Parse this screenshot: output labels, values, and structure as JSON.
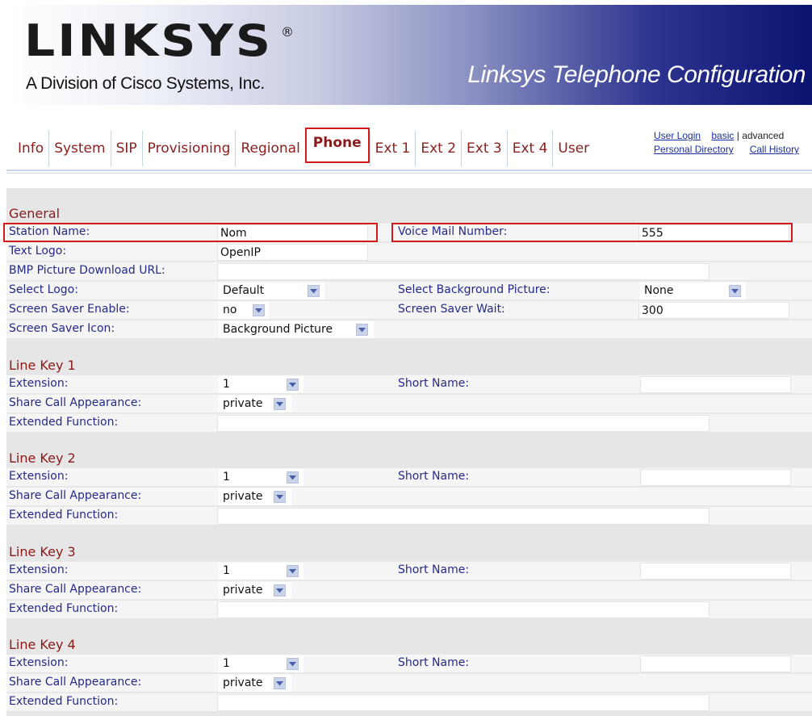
{
  "header": {
    "logo_text": "LINKSYS",
    "logo_registered": "®",
    "logo_subtitle": "A Division of Cisco Systems, Inc.",
    "title": "Linksys Telephone Configuration"
  },
  "tabs": [
    {
      "label": "Info"
    },
    {
      "label": "System"
    },
    {
      "label": "SIP"
    },
    {
      "label": "Provisioning"
    },
    {
      "label": "Regional"
    },
    {
      "label": "Phone"
    },
    {
      "label": "Ext 1"
    },
    {
      "label": "Ext 2"
    },
    {
      "label": "Ext 3"
    },
    {
      "label": "Ext 4"
    },
    {
      "label": "User"
    }
  ],
  "active_tab": "Phone",
  "top_links": {
    "user_login": "User Login",
    "basic": "basic",
    "separator": "|",
    "advanced": "advanced",
    "personal_directory": "Personal Directory",
    "call_history": "Call History"
  },
  "general": {
    "title": "General",
    "station_name_label": "Station Name:",
    "station_name_value": "Nom",
    "voice_mail_label": "Voice Mail Number:",
    "voice_mail_value": "555",
    "text_logo_label": "Text Logo:",
    "text_logo_value": "OpenIP",
    "bmp_url_label": "BMP Picture Download URL:",
    "bmp_url_value": "",
    "select_logo_label": "Select Logo:",
    "select_logo_value": "Default",
    "select_bg_label": "Select Background Picture:",
    "select_bg_value": "None",
    "screen_saver_enable_label": "Screen Saver Enable:",
    "screen_saver_enable_value": "no",
    "screen_saver_wait_label": "Screen Saver Wait:",
    "screen_saver_wait_value": "300",
    "screen_saver_icon_label": "Screen Saver Icon:",
    "screen_saver_icon_value": "Background Picture"
  },
  "line_keys": [
    {
      "title": "Line Key 1",
      "extension_label": "Extension:",
      "extension_value": "1",
      "short_name_label": "Short Name:",
      "short_name_value": "",
      "share_label": "Share Call Appearance:",
      "share_value": "private",
      "extended_label": "Extended Function:",
      "extended_value": ""
    },
    {
      "title": "Line Key 2",
      "extension_label": "Extension:",
      "extension_value": "1",
      "short_name_label": "Short Name:",
      "short_name_value": "",
      "share_label": "Share Call Appearance:",
      "share_value": "private",
      "extended_label": "Extended Function:",
      "extended_value": ""
    },
    {
      "title": "Line Key 3",
      "extension_label": "Extension:",
      "extension_value": "1",
      "short_name_label": "Short Name:",
      "short_name_value": "",
      "share_label": "Share Call Appearance:",
      "share_value": "private",
      "extended_label": "Extended Function:",
      "extended_value": ""
    },
    {
      "title": "Line Key 4",
      "extension_label": "Extension:",
      "extension_value": "1",
      "short_name_label": "Short Name:",
      "short_name_value": "",
      "share_label": "Share Call Appearance:",
      "share_value": "private",
      "extended_label": "Extended Function:",
      "extended_value": ""
    }
  ],
  "colors": {
    "label_blue": "#242a8a",
    "section_red": "#8b1a1a",
    "highlight_red": "#d11a1a",
    "banner_navy": "#0a1370"
  }
}
